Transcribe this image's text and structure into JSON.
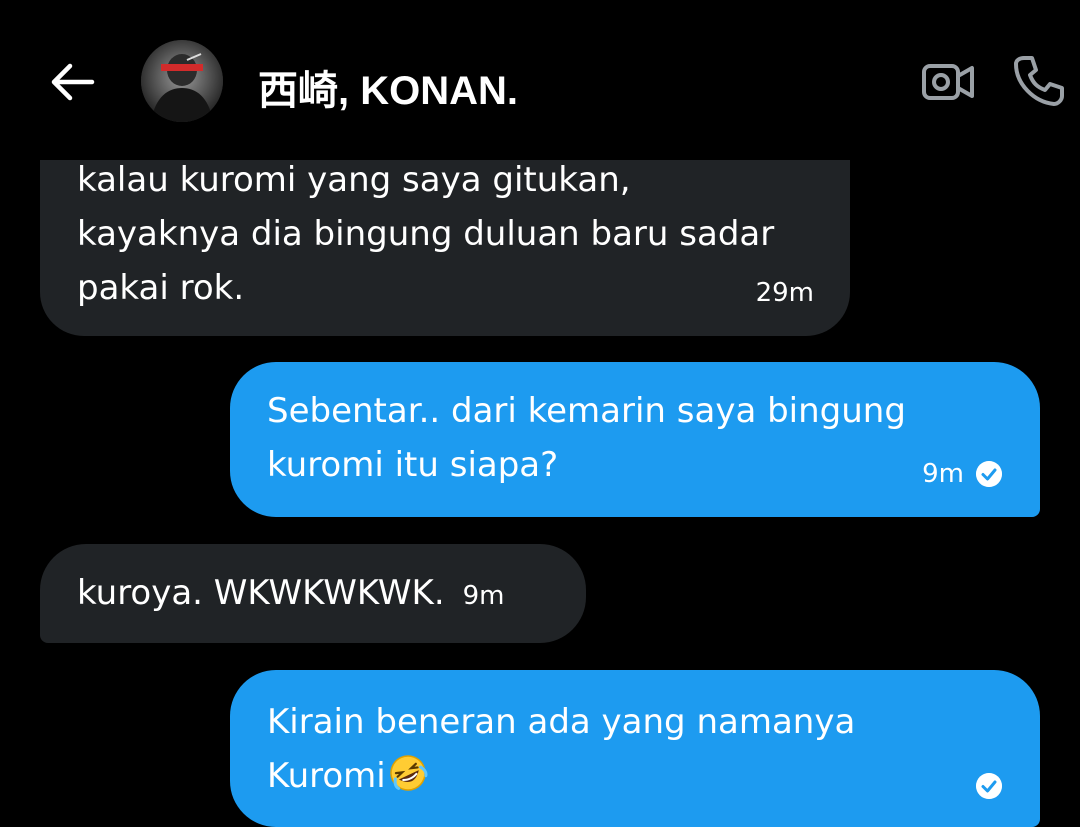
{
  "header": {
    "title": "西崎, KONAN.",
    "back_icon": "arrow-left-icon",
    "video_icon": "video-camera-icon",
    "call_icon": "phone-icon"
  },
  "colors": {
    "background": "#000000",
    "incoming_bubble": "#202326",
    "outgoing_bubble": "#1d9bf0",
    "text": "#ffffff"
  },
  "messages": [
    {
      "direction": "incoming",
      "lines": [
        "kalau kuromi yang saya gitukan,",
        "kayaknya dia bingung duluan baru sadar",
        "pakai rok."
      ],
      "time": "29m"
    },
    {
      "direction": "outgoing",
      "lines": [
        "Sebentar.. dari kemarin saya bingung",
        "kuromi itu siapa?"
      ],
      "time": "9m",
      "status_icon": "check-circle-icon"
    },
    {
      "direction": "incoming",
      "lines": [
        "kuroya. WKWKWKWK."
      ],
      "time": "9m"
    },
    {
      "direction": "outgoing",
      "lines": [
        "Kirain beneran ada yang namanya",
        "Kuromi"
      ],
      "emoji": "rolling-on-floor-laughing-emoji",
      "status_icon": "check-circle-icon"
    }
  ]
}
